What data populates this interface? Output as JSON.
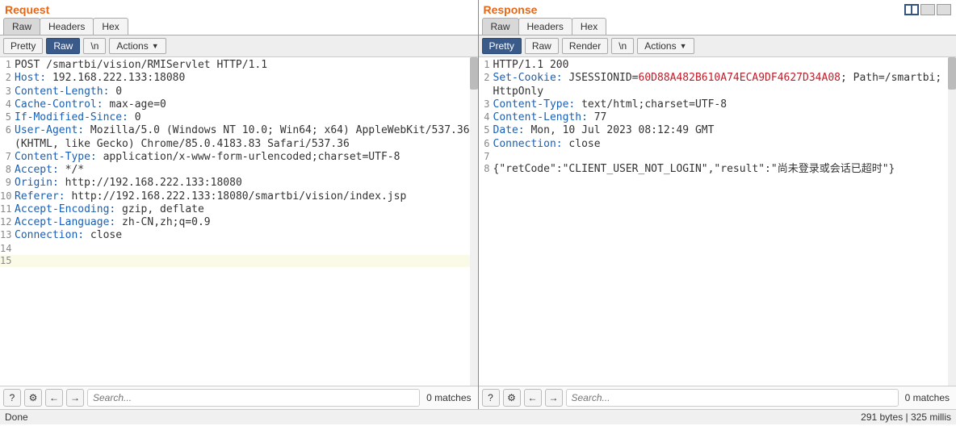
{
  "request": {
    "title": "Request",
    "tabs": [
      "Raw",
      "Headers",
      "Hex"
    ],
    "activeTab": "Raw",
    "subtabs": {
      "pretty": "Pretty",
      "raw": "Raw",
      "newline": "\\n",
      "actions": "Actions"
    },
    "lines": [
      {
        "n": "1",
        "plain": "POST /smartbi/vision/RMIServlet HTTP/1.1"
      },
      {
        "n": "2",
        "h": "Host",
        "v": " 192.168.222.133:18080"
      },
      {
        "n": "3",
        "h": "Content-Length",
        "v": " 0"
      },
      {
        "n": "4",
        "h": "Cache-Control",
        "v": " max-age=0"
      },
      {
        "n": "5",
        "h": "If-Modified-Since",
        "v": " 0"
      },
      {
        "n": "6",
        "h": "User-Agent",
        "v": " Mozilla/5.0 (Windows NT 10.0; Win64; x64) AppleWebKit/537.36 (KHTML, like Gecko) Chrome/85.0.4183.83 Safari/537.36",
        "wrap": true
      },
      {
        "n": "7",
        "h": "Content-Type",
        "v": " application/x-www-form-urlencoded;charset=UTF-8"
      },
      {
        "n": "8",
        "h": "Accept",
        "v": " */*"
      },
      {
        "n": "9",
        "h": "Origin",
        "v": " http://192.168.222.133:18080"
      },
      {
        "n": "10",
        "h": "Referer",
        "v": " http://192.168.222.133:18080/smartbi/vision/index.jsp"
      },
      {
        "n": "11",
        "h": "Accept-Encoding",
        "v": " gzip, deflate"
      },
      {
        "n": "12",
        "h": "Accept-Language",
        "v": " zh-CN,zh;q=0.9"
      },
      {
        "n": "13",
        "h": "Connection",
        "v": " close"
      },
      {
        "n": "14",
        "plain": ""
      },
      {
        "n": "15",
        "plain": "",
        "hl": true
      }
    ],
    "searchPlaceholder": "Search...",
    "matches": "0 matches"
  },
  "response": {
    "title": "Response",
    "tabs": [
      "Raw",
      "Headers",
      "Hex"
    ],
    "activeTab": "Raw",
    "subtabs": {
      "pretty": "Pretty",
      "raw": "Raw",
      "render": "Render",
      "newline": "\\n",
      "actions": "Actions"
    },
    "lines": [
      {
        "n": "1",
        "plain": "HTTP/1.1 200"
      },
      {
        "n": "2",
        "h": "Set-Cookie",
        "cookie": {
          "pre": " JSESSIONID=",
          "sess": "60D88A482B610A74ECA9DF4627D34A08",
          "post": "; Path=/smartbi; HttpOnly"
        }
      },
      {
        "n": "3",
        "h": "Content-Type",
        "v": " text/html;charset=UTF-8"
      },
      {
        "n": "4",
        "h": "Content-Length",
        "v": " 77"
      },
      {
        "n": "5",
        "h": "Date",
        "v": " Mon, 10 Jul 2023 08:12:49 GMT"
      },
      {
        "n": "6",
        "h": "Connection",
        "v": " close"
      },
      {
        "n": "7",
        "plain": ""
      },
      {
        "n": "8",
        "plain": "{\"retCode\":\"CLIENT_USER_NOT_LOGIN\",\"result\":\"尚未登录或会话已超时\"}"
      }
    ],
    "searchPlaceholder": "Search...",
    "matches": "0 matches"
  },
  "status": {
    "left": "Done",
    "right": "291 bytes | 325 millis"
  }
}
